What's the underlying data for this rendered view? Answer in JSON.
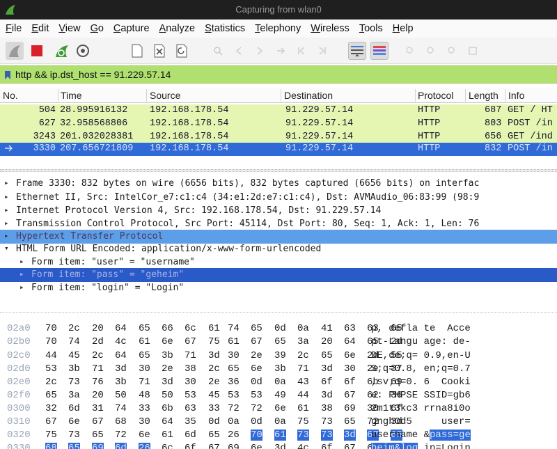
{
  "window": {
    "title": "Capturing from wlan0"
  },
  "menu": [
    "File",
    "Edit",
    "View",
    "Go",
    "Capture",
    "Analyze",
    "Statistics",
    "Telephony",
    "Wireless",
    "Tools",
    "Help"
  ],
  "toolbar": {
    "icons": [
      "shark-fin-start-icon",
      "stop-square-icon",
      "restart-fin-icon",
      "capture-options-icon",
      "open-file-icon",
      "close-file-icon",
      "reload-icon",
      "colorize-icon",
      "resize-columns-icon"
    ]
  },
  "filter": {
    "value": "http && ip.dst_host == 91.229.57.14",
    "color": "#afe070"
  },
  "packet_list": {
    "columns": [
      "No.",
      "Time",
      "Source",
      "Destination",
      "Protocol",
      "Length",
      "Info"
    ],
    "rows": [
      {
        "no": "504",
        "time": "28.995916132",
        "source": "192.168.178.54",
        "destination": "91.229.57.14",
        "protocol": "HTTP",
        "length": "687",
        "info": "GET / HT"
      },
      {
        "no": "627",
        "time": "32.958568806",
        "source": "192.168.178.54",
        "destination": "91.229.57.14",
        "protocol": "HTTP",
        "length": "803",
        "info": "POST /in"
      },
      {
        "no": "3243",
        "time": "201.032028381",
        "source": "192.168.178.54",
        "destination": "91.229.57.14",
        "protocol": "HTTP",
        "length": "656",
        "info": "GET /ind"
      },
      {
        "no": "3330",
        "time": "207.656721809",
        "source": "192.168.178.54",
        "destination": "91.229.57.14",
        "protocol": "HTTP",
        "length": "832",
        "info": "POST /in"
      }
    ],
    "selected_index": 3,
    "http_row_color": "#e4f6b1",
    "selection_color": "#2f6ad7"
  },
  "details": {
    "rows": [
      {
        "text": "Frame 3330: 832 bytes on wire (6656 bits), 832 bytes captured (6656 bits) on interfac"
      },
      {
        "text": "Ethernet II, Src: IntelCor_e7:c1:c4 (34:e1:2d:e7:c1:c4), Dst: AVMAudio_06:83:99 (98:9"
      },
      {
        "text": "Internet Protocol Version 4, Src: 192.168.178.54, Dst: 91.229.57.14"
      },
      {
        "text": "Transmission Control Protocol, Src Port: 45114, Dst Port: 80, Seq: 1, Ack: 1, Len: 76"
      },
      {
        "text": "Hypertext Transfer Protocol"
      },
      {
        "text": "HTML Form URL Encoded: application/x-www-form-urlencoded"
      },
      {
        "text": "Form item: \"user\" = \"username\""
      },
      {
        "text": "Form item: \"pass\" = \"geheim\""
      },
      {
        "text": "Form item: \"login\" = \"Login\""
      }
    ]
  },
  "hex": {
    "rows": [
      {
        "offset": "02a0",
        "bytes": [
          "70",
          "2c",
          "20",
          "64",
          "65",
          "66",
          "6c",
          "61",
          "74",
          "65",
          "0d",
          "0a",
          "41",
          "63",
          "63",
          "65"
        ],
        "ascii_a": "p, defla",
        "ascii_b": "te  Acce"
      },
      {
        "offset": "02b0",
        "bytes": [
          "70",
          "74",
          "2d",
          "4c",
          "61",
          "6e",
          "67",
          "75",
          "61",
          "67",
          "65",
          "3a",
          "20",
          "64",
          "65",
          "2d"
        ],
        "ascii_a": "pt-Langu",
        "ascii_b": "age: de-"
      },
      {
        "offset": "02c0",
        "bytes": [
          "44",
          "45",
          "2c",
          "64",
          "65",
          "3b",
          "71",
          "3d",
          "30",
          "2e",
          "39",
          "2c",
          "65",
          "6e",
          "2d",
          "55"
        ],
        "ascii_a": "DE,de;q=",
        "ascii_b": "0.9,en-U"
      },
      {
        "offset": "02d0",
        "bytes": [
          "53",
          "3b",
          "71",
          "3d",
          "30",
          "2e",
          "38",
          "2c",
          "65",
          "6e",
          "3b",
          "71",
          "3d",
          "30",
          "2e",
          "37"
        ],
        "ascii_a": "S;q=0.8,",
        "ascii_b": "en;q=0.7"
      },
      {
        "offset": "02e0",
        "bytes": [
          "2c",
          "73",
          "76",
          "3b",
          "71",
          "3d",
          "30",
          "2e",
          "36",
          "0d",
          "0a",
          "43",
          "6f",
          "6f",
          "6b",
          "69"
        ],
        "ascii_a": ",sv;q=0.",
        "ascii_b": "6  Cooki"
      },
      {
        "offset": "02f0",
        "bytes": [
          "65",
          "3a",
          "20",
          "50",
          "48",
          "50",
          "53",
          "45",
          "53",
          "53",
          "49",
          "44",
          "3d",
          "67",
          "62",
          "36"
        ],
        "ascii_a": "e: PHPSE",
        "ascii_b": "SSID=gb6"
      },
      {
        "offset": "0300",
        "bytes": [
          "32",
          "6d",
          "31",
          "74",
          "33",
          "6b",
          "63",
          "33",
          "72",
          "72",
          "6e",
          "61",
          "38",
          "69",
          "30",
          "6f"
        ],
        "ascii_a": "2m1t3kc3",
        "ascii_b": "rrna8i0o"
      },
      {
        "offset": "0310",
        "bytes": [
          "67",
          "6e",
          "67",
          "68",
          "30",
          "64",
          "35",
          "0d",
          "0a",
          "0d",
          "0a",
          "75",
          "73",
          "65",
          "72",
          "3d"
        ],
        "ascii_a": "gngh0d5",
        "ascii_b": "    user="
      },
      {
        "offset": "0320",
        "bytes": [
          "75",
          "73",
          "65",
          "72",
          "6e",
          "61",
          "6d",
          "65",
          "26",
          "70",
          "61",
          "73",
          "73",
          "3d",
          "67",
          "65"
        ],
        "ascii_a": "username",
        "ascii_b": "&pass=ge"
      },
      {
        "offset": "0330",
        "bytes": [
          "68",
          "65",
          "69",
          "6d",
          "26",
          "6c",
          "6f",
          "67",
          "69",
          "6e",
          "3d",
          "4c",
          "6f",
          "67",
          "69",
          "6e"
        ],
        "ascii_a": "heim&log",
        "ascii_b": "in=Login"
      }
    ]
  }
}
